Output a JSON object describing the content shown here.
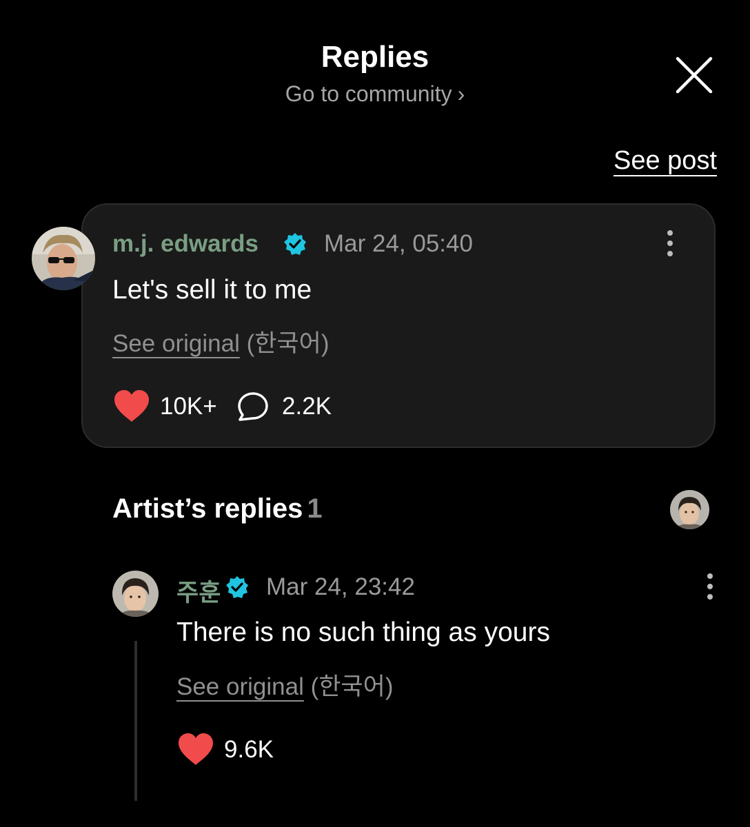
{
  "header": {
    "title": "Replies",
    "subtitle": "Go to community",
    "subtitle_chevron": "›",
    "close_icon": "close-icon"
  },
  "see_post_label": "See post",
  "post": {
    "author": "m.j. edwards",
    "verified_icon": "verified-badge-icon",
    "date": "Mar 24, 05:40",
    "text": "Let's sell it to me",
    "see_original": "See original",
    "language": "(한국어)",
    "likes": "10K+",
    "comments": "2.2K"
  },
  "artist_replies": {
    "title": "Artist’s replies",
    "count": "1"
  },
  "reply": {
    "author": "주훈",
    "verified_icon": "verified-badge-icon",
    "date": "Mar 24, 23:42",
    "text": "There is no such thing as yours",
    "see_original": "See original",
    "language": "(한국어)",
    "likes": "9.6K"
  },
  "colors": {
    "background": "#000000",
    "card": "#1a1a1a",
    "author_name": "#7a9e83",
    "verified": "#1fc4e0",
    "heart": "#f24b4b",
    "muted": "#9a9a9a"
  }
}
